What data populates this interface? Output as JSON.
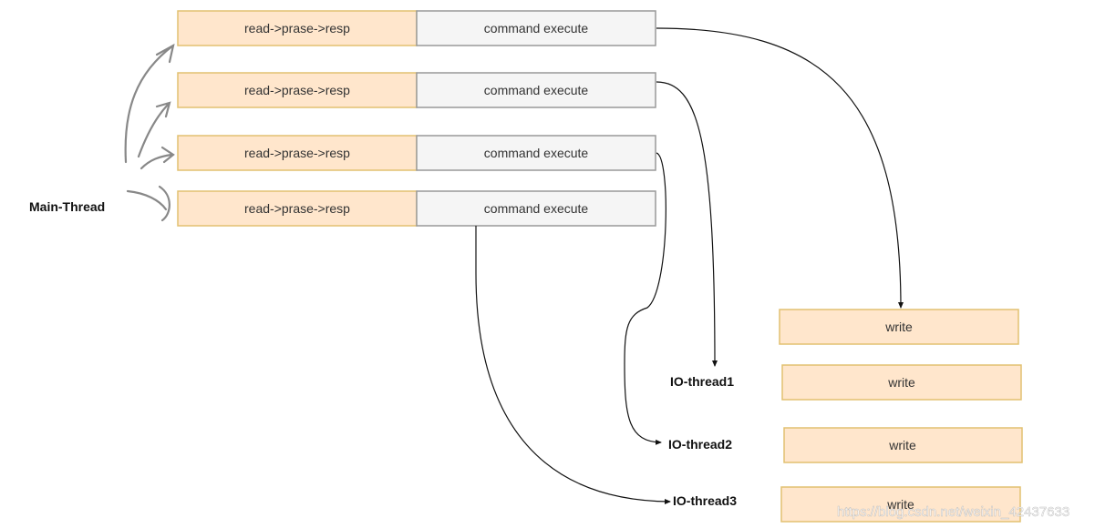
{
  "main_thread_label": "Main-Thread",
  "rows": [
    {
      "stage1": "read->prase->resp",
      "stage2": "command execute"
    },
    {
      "stage1": "read->prase->resp",
      "stage2": "command execute"
    },
    {
      "stage1": "read->prase->resp",
      "stage2": "command execute"
    },
    {
      "stage1": "read->prase->resp",
      "stage2": "command execute"
    }
  ],
  "io_threads": [
    "IO-thread1",
    "IO-thread2",
    "IO-thread3"
  ],
  "writes": [
    "write",
    "write",
    "write",
    "write"
  ],
  "watermark": "https://blog.csdn.net/weixin_42437633",
  "colors": {
    "orange_fill": "#ffe6cc",
    "orange_stroke": "#d6b656",
    "gray_fill": "#f5f5f5",
    "gray_stroke": "#999999"
  }
}
